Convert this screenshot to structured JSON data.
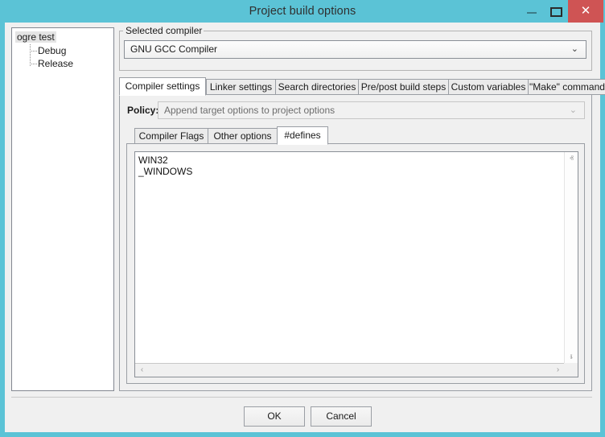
{
  "window": {
    "title": "Project build options",
    "accent_color": "#5bc3d6",
    "close_color": "#cf5454",
    "controls": {
      "minimize": "minimize",
      "maximize": "maximize",
      "close": "✕"
    }
  },
  "tree": {
    "root": "ogre test",
    "children": [
      "Debug",
      "Release"
    ]
  },
  "compiler_group": {
    "label": "Selected compiler",
    "selected": "GNU GCC Compiler",
    "arrow": "⌄"
  },
  "tabs": [
    {
      "label": "Compiler settings",
      "active": true
    },
    {
      "label": "Linker settings",
      "active": false
    },
    {
      "label": "Search directories",
      "active": false
    },
    {
      "label": "Pre/post build steps",
      "active": false
    },
    {
      "label": "Custom variables",
      "active": false
    },
    {
      "label": "\"Make\" commands",
      "active": false
    }
  ],
  "policy": {
    "label": "Policy:",
    "value": "Append target options to project options",
    "arrow": "⌄",
    "disabled": true
  },
  "inner_tabs": [
    {
      "label": "Compiler Flags",
      "active": false
    },
    {
      "label": "Other options",
      "active": false
    },
    {
      "label": "#defines",
      "active": true
    }
  ],
  "defines": {
    "lines": [
      "WIN32",
      "_WINDOWS"
    ],
    "text": "WIN32\n_WINDOWS"
  },
  "scrollbars": {
    "up": "ⱏ",
    "down": "ⱛ",
    "left": "‹",
    "right": "›"
  },
  "buttons": {
    "ok": "OK",
    "cancel": "Cancel"
  }
}
